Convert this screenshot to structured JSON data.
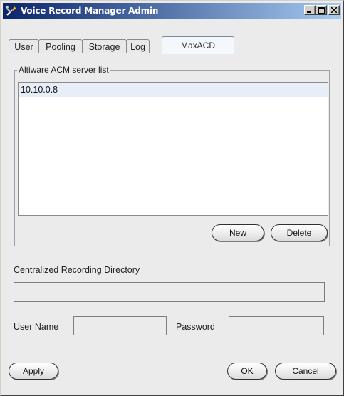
{
  "window": {
    "title": "Voice Record Manager Admin",
    "titlebar_buttons": [
      "minimize-icon",
      "maximize-icon",
      "close-icon"
    ]
  },
  "tabs": [
    {
      "label": "User",
      "active": false
    },
    {
      "label": "Pooling",
      "active": false
    },
    {
      "label": "Storage",
      "active": false
    },
    {
      "label": "Log",
      "active": false
    },
    {
      "label": "MaxACD",
      "active": true
    }
  ],
  "server_list": {
    "legend": "Altiware ACM server list",
    "items": [
      "10.10.0.8"
    ],
    "new_label": "New",
    "delete_label": "Delete"
  },
  "recording": {
    "directory_label": "Centralized Recording Directory",
    "directory_value": "",
    "username_label": "User Name",
    "username_value": "",
    "password_label": "Password",
    "password_value": ""
  },
  "footer": {
    "apply_label": "Apply",
    "ok_label": "OK",
    "cancel_label": "Cancel"
  },
  "colors": {
    "titlebar_start": "#0a246a",
    "titlebar_end": "#a6caf0",
    "window_bg": "#ebebeb"
  }
}
